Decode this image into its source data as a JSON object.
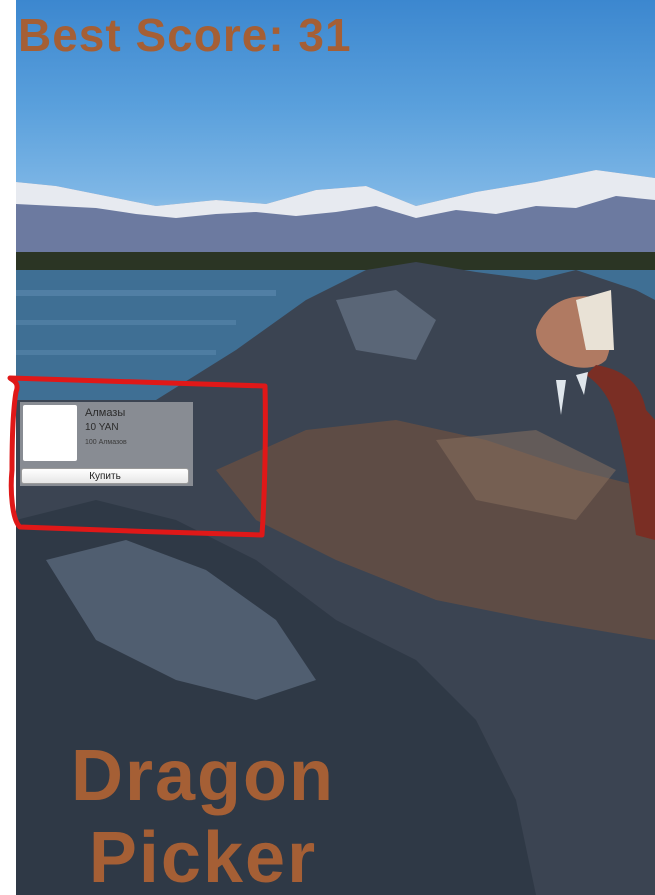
{
  "hud": {
    "best_score_text": "Best Score: 31"
  },
  "title": {
    "line1": "Dragon",
    "line2": "Picker"
  },
  "shop_item": {
    "name": "Алмазы",
    "price": "10 YAN",
    "description": "100 Алмазов",
    "buy_label": "Купить"
  },
  "colors": {
    "text_accent": "#a55f35",
    "annotation_stroke": "#e01818",
    "panel_bg": "#c8c8c8"
  }
}
